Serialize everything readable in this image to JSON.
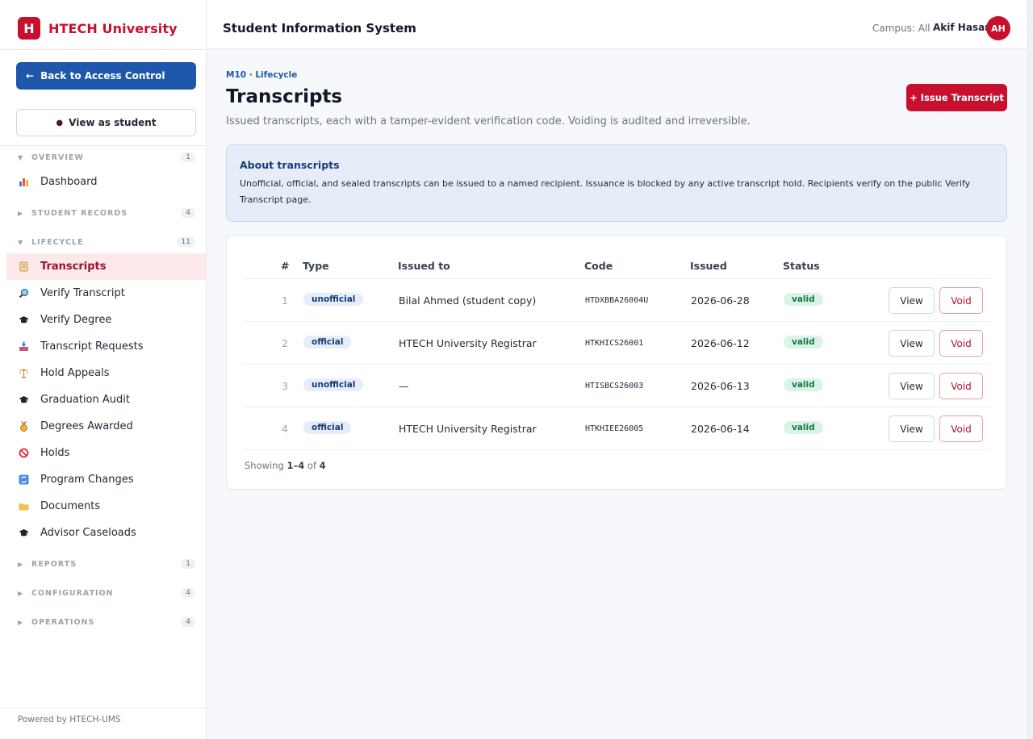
{
  "brand": {
    "logo_letter": "H",
    "name": "HTECH University"
  },
  "sidebar": {
    "back_label": "Back to Access Control",
    "view_as_label": "View as student",
    "groups": [
      {
        "label": "OVERVIEW",
        "count": "1",
        "expanded": true
      },
      {
        "label": "STUDENT RECORDS",
        "count": "4",
        "expanded": false
      },
      {
        "label": "LIFECYCLE",
        "count": "11",
        "expanded": true
      },
      {
        "label": "REPORTS",
        "count": "1",
        "expanded": false
      },
      {
        "label": "CONFIGURATION",
        "count": "4",
        "expanded": false
      },
      {
        "label": "OPERATIONS",
        "count": "4",
        "expanded": false
      }
    ],
    "overview_items": [
      {
        "label": "Dashboard",
        "icon": "bar-chart-icon"
      }
    ],
    "lifecycle_items": [
      {
        "label": "Transcripts",
        "icon": "scroll-icon",
        "active": true
      },
      {
        "label": "Verify Transcript",
        "icon": "magnifier-icon"
      },
      {
        "label": "Verify Degree",
        "icon": "graduation-cap-icon"
      },
      {
        "label": "Transcript Requests",
        "icon": "inbox-tray-icon"
      },
      {
        "label": "Hold Appeals",
        "icon": "balance-scale-icon"
      },
      {
        "label": "Graduation Audit",
        "icon": "graduation-cap-icon"
      },
      {
        "label": "Degrees Awarded",
        "icon": "medal-icon"
      },
      {
        "label": "Holds",
        "icon": "prohibited-icon"
      },
      {
        "label": "Program Changes",
        "icon": "refresh-icon"
      },
      {
        "label": "Documents",
        "icon": "folder-icon"
      },
      {
        "label": "Advisor Caseloads",
        "icon": "graduation-cap-icon"
      }
    ],
    "footer": "Powered by HTECH-UMS"
  },
  "topbar": {
    "title": "Student Information System",
    "campus": "Campus: All",
    "user_name": "Akif Hasan",
    "user_initials": "AH"
  },
  "page": {
    "breadcrumb": "M10 · Lifecycle",
    "title": "Transcripts",
    "subtitle": "Issued transcripts, each with a tamper-evident verification code. Voiding is audited and irreversible.",
    "issue_button": "+ Issue Transcript"
  },
  "info": {
    "title": "About transcripts",
    "text": "Unofficial, official, and sealed transcripts can be issued to a named recipient. Issuance is blocked by any active transcript hold. Recipients verify on the public Verify Transcript page."
  },
  "table": {
    "headers": {
      "num": "#",
      "type": "Type",
      "issued_to": "Issued to",
      "code": "Code",
      "issued": "Issued",
      "status": "Status"
    },
    "rows": [
      {
        "num": "1",
        "type": "unofficial",
        "issued_to": "Bilal Ahmed (student copy)",
        "code": "HTDXBBA26004U",
        "issued": "2026-06-28",
        "status": "valid"
      },
      {
        "num": "2",
        "type": "official",
        "issued_to": "HTECH University Registrar",
        "code": "HTKHICS26001",
        "issued": "2026-06-12",
        "status": "valid"
      },
      {
        "num": "3",
        "type": "unofficial",
        "issued_to": "—",
        "code": "HTISBCS26003",
        "issued": "2026-06-13",
        "status": "valid"
      },
      {
        "num": "4",
        "type": "official",
        "issued_to": "HTECH University Registrar",
        "code": "HTKHIEE26005",
        "issued": "2026-06-14",
        "status": "valid"
      }
    ],
    "view_label": "View",
    "void_label": "Void",
    "showing_prefix": "Showing",
    "showing_range": "1–4",
    "showing_of": "of",
    "showing_total": "4"
  }
}
